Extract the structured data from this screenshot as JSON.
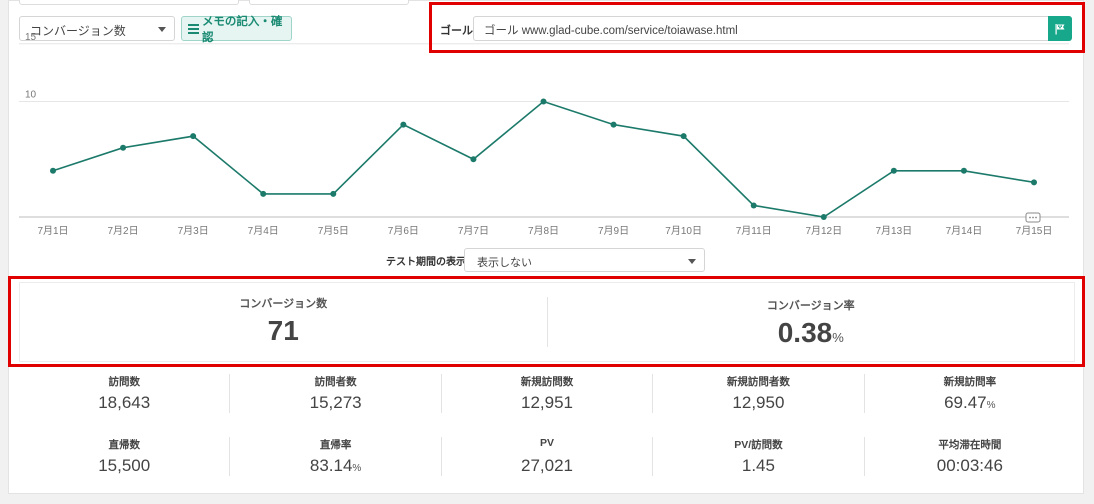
{
  "toolbar": {
    "metric_select": "コンバージョン数",
    "memo_button": "メモの記入・確認"
  },
  "goal": {
    "label": "ゴール",
    "value": "ゴール www.glad-cube.com/service/toiawase.html"
  },
  "colors": {
    "accent": "#17a88b",
    "line": "#1c7a6a",
    "highlight_border": "#e00000"
  },
  "chart_data": {
    "type": "line",
    "categories": [
      "7月1日",
      "7月2日",
      "7月3日",
      "7月4日",
      "7月5日",
      "7月6日",
      "7月7日",
      "7月8日",
      "7月9日",
      "7月10日",
      "7月11日",
      "7月12日",
      "7月13日",
      "7月14日",
      "7月15日"
    ],
    "series": [
      {
        "values": [
          4,
          6,
          7,
          2,
          2,
          8,
          5,
          10,
          8,
          7,
          1,
          0,
          4,
          4,
          3
        ]
      }
    ],
    "y_ticks": [
      "15",
      "10"
    ],
    "ylim": [
      0,
      15
    ],
    "grid": true,
    "annotation_icon": "comment-icon"
  },
  "period": {
    "label": "テスト期間の表示",
    "value": "表示しない"
  },
  "summary": [
    {
      "label": "コンバージョン数",
      "value": "71",
      "unit": ""
    },
    {
      "label": "コンバージョン率",
      "value": "0.38",
      "unit": "%"
    }
  ],
  "stats_row1": [
    {
      "label": "訪問数",
      "value": "18,643",
      "unit": ""
    },
    {
      "label": "訪問者数",
      "value": "15,273",
      "unit": ""
    },
    {
      "label": "新規訪問数",
      "value": "12,951",
      "unit": ""
    },
    {
      "label": "新規訪問者数",
      "value": "12,950",
      "unit": ""
    },
    {
      "label": "新規訪問率",
      "value": "69.47",
      "unit": "%"
    }
  ],
  "stats_row2": [
    {
      "label": "直帰数",
      "value": "15,500",
      "unit": ""
    },
    {
      "label": "直帰率",
      "value": "83.14",
      "unit": "%"
    },
    {
      "label": "PV",
      "value": "27,021",
      "unit": ""
    },
    {
      "label": "PV/訪問数",
      "value": "1.45",
      "unit": ""
    },
    {
      "label": "平均滞在時間",
      "value": "00:03:46",
      "unit": ""
    }
  ]
}
